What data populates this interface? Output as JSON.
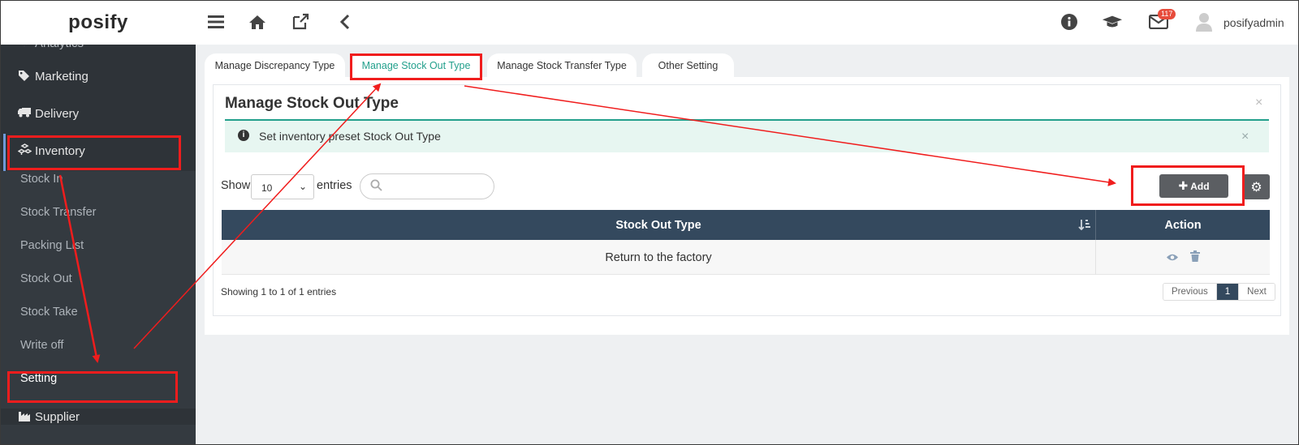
{
  "app": {
    "logo": "posify"
  },
  "topbar": {
    "menu_icon": "hamburger-icon",
    "home_icon": "home-icon",
    "external_icon": "external-link-icon",
    "back_icon": "chevron-left-icon",
    "info_icon": "info-icon",
    "training_icon": "graduation-cap-icon",
    "mail_icon": "envelope-icon",
    "mail_badge": "117",
    "user_name": "posifyadmin"
  },
  "sidebar": {
    "items": [
      {
        "label": "Marketing",
        "icon": "tag-icon"
      },
      {
        "label": "Delivery",
        "icon": "truck-icon"
      },
      {
        "label": "Inventory",
        "icon": "cubes-icon"
      },
      {
        "label": "Supplier",
        "icon": "factory-icon"
      }
    ],
    "sub_items": [
      {
        "label": "Stock In"
      },
      {
        "label": "Stock Transfer"
      },
      {
        "label": "Packing List"
      },
      {
        "label": "Stock Out"
      },
      {
        "label": "Stock Take"
      },
      {
        "label": "Write off"
      },
      {
        "label": "Setting"
      }
    ]
  },
  "tabs": [
    {
      "label": "Manage Discrepancy Type"
    },
    {
      "label": "Manage Stock Out Type"
    },
    {
      "label": "Manage Stock Transfer Type"
    },
    {
      "label": "Other Setting"
    }
  ],
  "panel": {
    "title": "Manage Stock Out Type",
    "close": "×",
    "alert_text": "Set inventory preset Stock Out Type",
    "alert_close": "×",
    "show_label": "Show",
    "entries_value": "10",
    "entries_label": "entries",
    "add_label": "Add"
  },
  "table": {
    "columns": [
      "Stock Out Type",
      "Action"
    ],
    "rows": [
      {
        "stock_out_type": "Return to the factory"
      }
    ],
    "info": "Showing 1 to 1 of 1 entries"
  },
  "pagination": {
    "previous": "Previous",
    "current": "1",
    "next": "Next"
  },
  "colors": {
    "sidebar_bg": "#2e3338",
    "accent": "#23a08c",
    "table_header": "#34495e",
    "annotation": "#f01d1d"
  }
}
